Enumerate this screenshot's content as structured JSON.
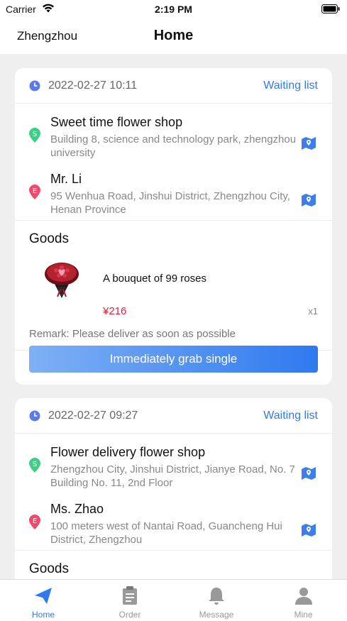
{
  "status_bar": {
    "carrier": "Carrier",
    "time": "2:19 PM"
  },
  "nav": {
    "city": "Zhengzhou",
    "title": "Home"
  },
  "colors": {
    "accent": "#2f7af0",
    "price": "#e0203a",
    "pin_sender": "#3ecf85",
    "pin_receiver": "#ef4a6a"
  },
  "orders": [
    {
      "datetime": "2022-02-27 10:11",
      "status": "Waiting list",
      "sender": {
        "name": "Sweet time flower shop",
        "address": "Building 8, science and technology park, zhengzhou university",
        "badge": "S"
      },
      "receiver": {
        "name": "Mr. Li",
        "address": "95 Wenhua Road, Jinshui District, Zhengzhou City, Henan Province",
        "badge": "E"
      },
      "goods_title": "Goods",
      "item": {
        "name": "A bouquet of 99 roses",
        "price": "¥216",
        "qty": "x1"
      },
      "remark": "Remark: Please deliver as soon as possible",
      "action": "Immediately grab single"
    },
    {
      "datetime": "2022-02-27 09:27",
      "status": "Waiting list",
      "sender": {
        "name": "Flower delivery flower shop",
        "address": "Zhengzhou City, Jinshui District, Jianye Road, No. 7 Building No. 11, 2nd Floor",
        "badge": "S"
      },
      "receiver": {
        "name": "Ms. Zhao",
        "address": "100 meters west of Nantai Road, Guancheng Hui District, Zhengzhou",
        "badge": "E"
      },
      "goods_title": "Goods"
    }
  ],
  "tabs": [
    {
      "label": "Home",
      "icon": "paper-plane-icon",
      "active": true
    },
    {
      "label": "Order",
      "icon": "clipboard-icon",
      "active": false
    },
    {
      "label": "Message",
      "icon": "bell-icon",
      "active": false
    },
    {
      "label": "Mine",
      "icon": "person-icon",
      "active": false
    }
  ]
}
